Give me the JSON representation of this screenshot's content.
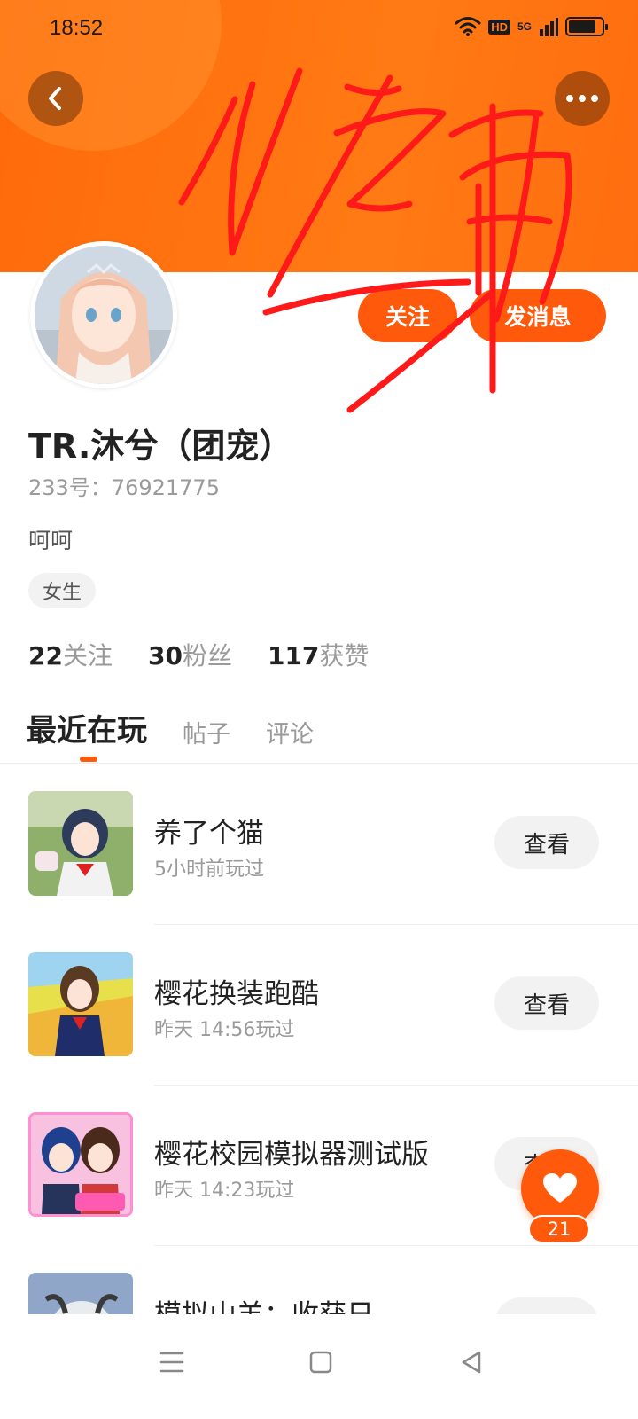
{
  "status_bar": {
    "time": "18:52",
    "hd_label": "HD",
    "network": "5G",
    "battery_level": 0.85
  },
  "header": {
    "back_icon": "chevron-left-icon",
    "more_icon": "more-dots-icon"
  },
  "profile": {
    "follow_label": "关注",
    "message_label": "发消息",
    "username": "TR.沐兮（团宠）",
    "uid": "233号：76921775",
    "bio": "呵呵",
    "gender_tag": "女生",
    "stats": [
      {
        "num": "22",
        "label": "关注"
      },
      {
        "num": "30",
        "label": "粉丝"
      },
      {
        "num": "117",
        "label": "获赞"
      }
    ]
  },
  "tabs": [
    {
      "label": "最近在玩",
      "active": true
    },
    {
      "label": "帖子",
      "active": false
    },
    {
      "label": "评论",
      "active": false
    }
  ],
  "games": [
    {
      "title": "养了个猫",
      "time": "5小时前玩过",
      "button": "查看"
    },
    {
      "title": "樱花换装跑酷",
      "time": "昨天 14:56玩过",
      "button": "查看"
    },
    {
      "title": "樱花校园模拟器测试版",
      "time": "昨天 14:23玩过",
      "button": "查看"
    },
    {
      "title": "模拟山羊：收获日",
      "time": "",
      "button": ""
    }
  ],
  "like_fab": {
    "count": "21",
    "icon": "heart-icon"
  },
  "nav_bar": {
    "menu_icon": "menu-icon",
    "home_icon": "square-icon",
    "back_icon": "triangle-back-icon"
  },
  "colors": {
    "brand": "#ff5a0b",
    "banner": "#ff7a14",
    "scribble": "#ff1a1a"
  }
}
